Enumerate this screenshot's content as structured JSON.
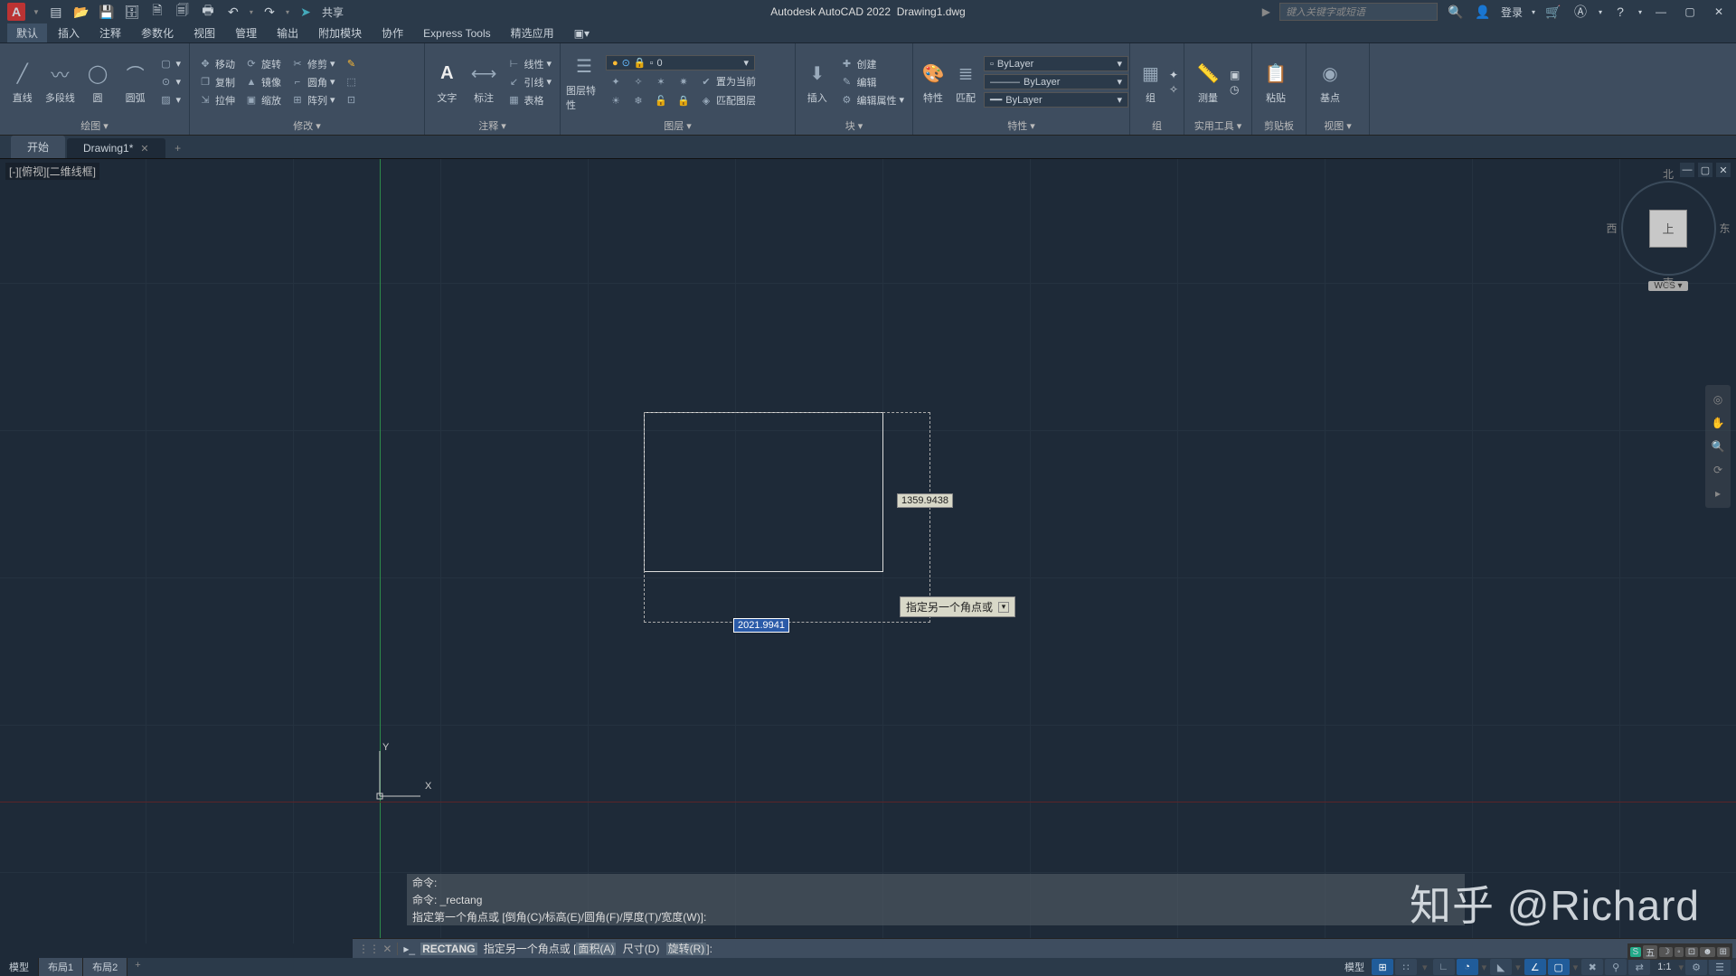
{
  "title": {
    "app": "Autodesk AutoCAD 2022",
    "file": "Drawing1.dwg"
  },
  "qat": {
    "share": "共享"
  },
  "search_placeholder": "键入关键字或短语",
  "login": "登录",
  "menus": [
    "默认",
    "插入",
    "注释",
    "参数化",
    "视图",
    "管理",
    "输出",
    "附加模块",
    "协作",
    "Express Tools",
    "精选应用"
  ],
  "ribbon": {
    "draw": {
      "label": "绘图 ▾",
      "line": "直线",
      "pline": "多段线",
      "circle": "圆",
      "arc": "圆弧"
    },
    "modify": {
      "label": "修改 ▾",
      "move": "移动",
      "rotate": "旋转",
      "trim": "修剪",
      "copy": "复制",
      "mirror": "镜像",
      "fillet": "圆角",
      "stretch": "拉伸",
      "scale": "缩放",
      "array": "阵列"
    },
    "annot": {
      "label": "注释 ▾",
      "text": "文字",
      "dim": "标注",
      "linetype": "线性",
      "leader": "引线",
      "table": "表格"
    },
    "layers": {
      "label": "图层 ▾",
      "props": "图层特性",
      "current": "ByLayer",
      "val": "0",
      "setcurrent": "置为当前",
      "matchlayer": "匹配图层"
    },
    "block": {
      "label": "块 ▾",
      "insert": "插入",
      "create": "创建",
      "edit": "编辑",
      "editattr": "编辑属性"
    },
    "props": {
      "label": "特性 ▾",
      "props": "特性",
      "match": "匹配",
      "bylayer": "ByLayer"
    },
    "group": {
      "label": "组",
      "group": "组"
    },
    "util": {
      "label": "实用工具 ▾",
      "measure": "测量"
    },
    "clip": {
      "label": "剪贴板",
      "paste": "粘贴"
    },
    "view": {
      "label": "视图 ▾",
      "base": "基点"
    }
  },
  "doctabs": {
    "start": "开始",
    "drawing": "Drawing1*"
  },
  "viewport": "[-][俯视][二维线框]",
  "viewcube": {
    "n": "北",
    "s": "南",
    "e": "东",
    "w": "西",
    "top": "上",
    "wcs": "WCS"
  },
  "ucs": {
    "x": "X",
    "y": "Y"
  },
  "dims": {
    "width": "2021.9941",
    "height": "1359.9438"
  },
  "tooltip": "指定另一个角点或",
  "history": {
    "l1": "命令:",
    "l2": "命令: _rectang",
    "l3": "指定第一个角点或 [倒角(C)/标高(E)/圆角(F)/厚度(T)/宽度(W)]:"
  },
  "cmd": {
    "cmd": "RECTANG",
    "prompt": "指定另一个角点或 [",
    "opt1": "面积(A)",
    "opt2": "尺寸(D)",
    "opt3": "旋转(R)",
    "end": "]:"
  },
  "layouts": {
    "model": "模型",
    "l1": "布局1",
    "l2": "布局2"
  },
  "status_scale": "1:1",
  "watermark": "知乎 @Richard",
  "ime": "五"
}
